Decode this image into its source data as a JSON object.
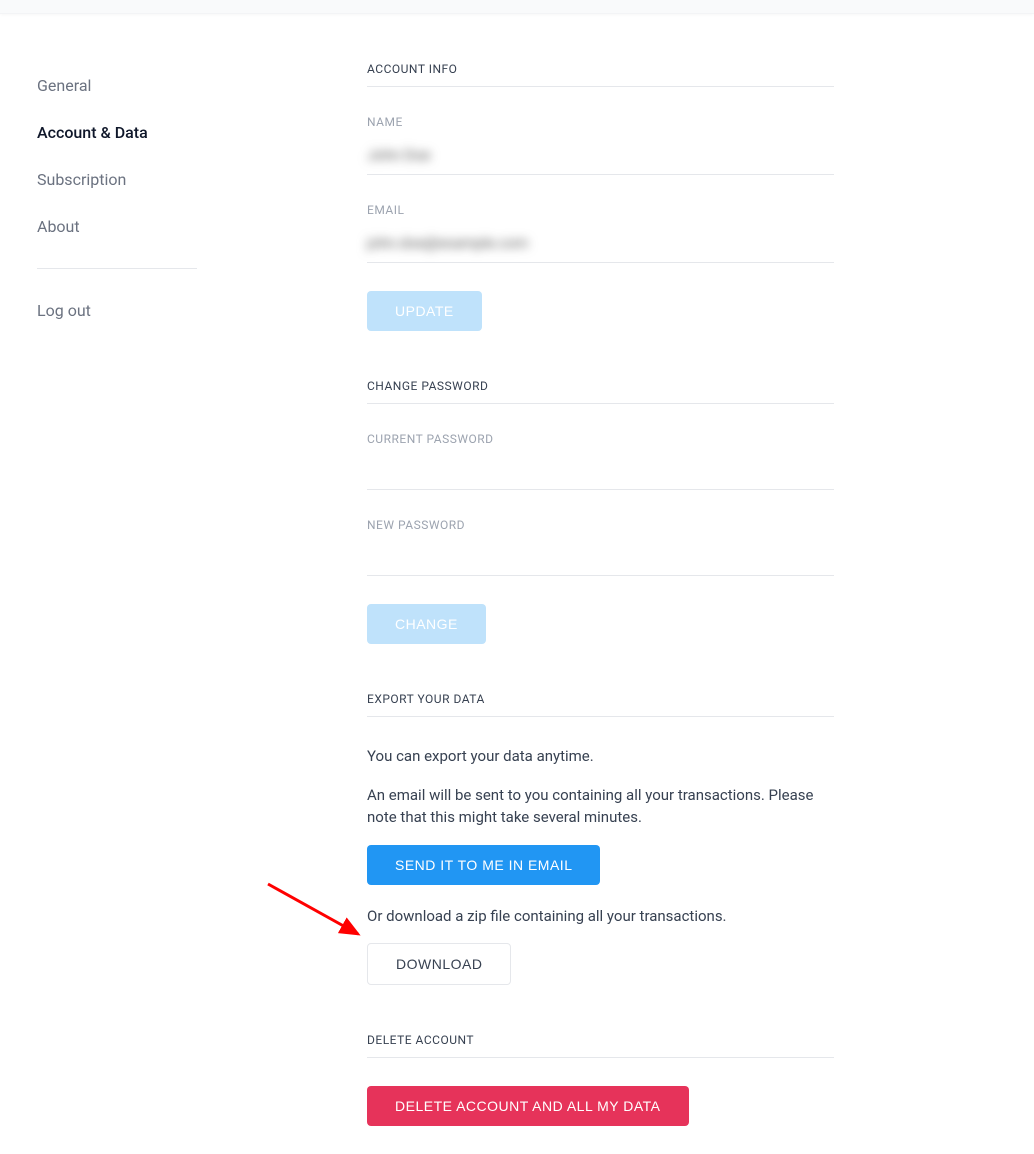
{
  "sidebar": {
    "items": [
      {
        "label": "General"
      },
      {
        "label": "Account & Data"
      },
      {
        "label": "Subscription"
      },
      {
        "label": "About"
      }
    ],
    "logout": "Log out"
  },
  "account_info": {
    "header": "ACCOUNT INFO",
    "name_label": "NAME",
    "name_value": "John Doe",
    "email_label": "EMAIL",
    "email_value": "john.doe@example.com",
    "update_button": "UPDATE"
  },
  "change_password": {
    "header": "CHANGE PASSWORD",
    "current_label": "CURRENT PASSWORD",
    "new_label": "NEW PASSWORD",
    "change_button": "CHANGE"
  },
  "export_data": {
    "header": "EXPORT YOUR DATA",
    "line1": "You can export your data anytime.",
    "line2": "An email will be sent to you containing all your transactions. Please note that this might take several minutes.",
    "email_button": "SEND IT TO ME IN EMAIL",
    "line3": "Or download a zip file containing all your transactions.",
    "download_button": "DOWNLOAD"
  },
  "delete_account": {
    "header": "DELETE ACCOUNT",
    "delete_button": "DELETE ACCOUNT AND ALL MY DATA"
  }
}
